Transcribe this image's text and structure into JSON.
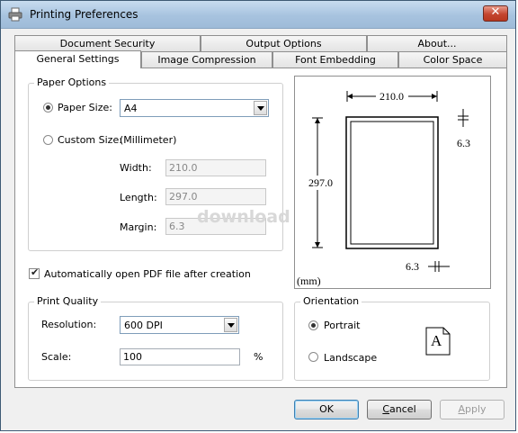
{
  "window": {
    "title": "Printing Preferences"
  },
  "tabs_back": [
    "Document Security",
    "Output Options",
    "About..."
  ],
  "tabs_front": [
    "General Settings",
    "Image Compression",
    "Font Embedding",
    "Color Space"
  ],
  "paper": {
    "group_label": "Paper Options",
    "paper_size_label": "Paper Size:",
    "paper_size_value": "A4",
    "custom_size_label": "Custom Size:",
    "units_note": "(Millimeter)",
    "width_label": "Width:",
    "width_value": "210.0",
    "length_label": "Length:",
    "length_value": "297.0",
    "margin_label": "Margin:",
    "margin_value": "6.3"
  },
  "auto_open_label": "Automatically open PDF file after creation",
  "preview": {
    "width": "210.0",
    "height": "297.0",
    "margin_right": "6.3",
    "margin_bottom": "6.3",
    "unit": "(mm)"
  },
  "quality": {
    "group_label": "Print Quality",
    "resolution_label": "Resolution:",
    "resolution_value": "600 DPI",
    "scale_label": "Scale:",
    "scale_value": "100",
    "percent": "%"
  },
  "orientation": {
    "group_label": "Orientation",
    "portrait_label": "Portrait",
    "landscape_label": "Landscape",
    "icon_letter": "A"
  },
  "buttons": {
    "ok": "OK",
    "cancel_prefix": "",
    "cancel_hotkey": "C",
    "cancel_rest": "ancel",
    "apply_prefix": "",
    "apply_hotkey": "A",
    "apply_rest": "pply"
  },
  "watermark": "download"
}
